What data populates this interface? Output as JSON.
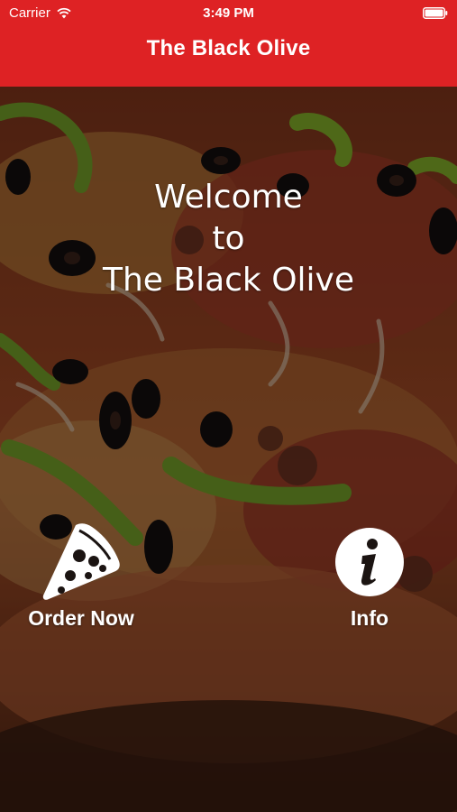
{
  "status_bar": {
    "carrier": "Carrier",
    "time": "3:49 PM",
    "wifi_icon": "wifi-icon",
    "battery_icon": "battery-icon"
  },
  "nav": {
    "title": "The Black Olive"
  },
  "welcome": {
    "line1": "Welcome",
    "line2": "to",
    "line3": "The Black Olive"
  },
  "actions": {
    "order": {
      "label": "Order Now",
      "icon": "pizza-slice-icon"
    },
    "info": {
      "label": "Info",
      "icon": "info-icon"
    }
  },
  "colors": {
    "brand_red": "#de2224",
    "text": "#ffffff"
  },
  "background": {
    "image": "pizza-photo"
  }
}
